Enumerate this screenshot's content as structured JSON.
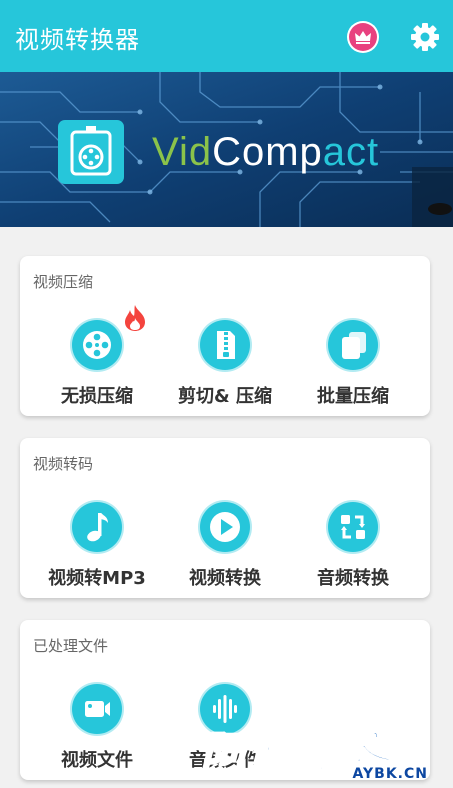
{
  "app": {
    "title": "视频转换器"
  },
  "topbar": {
    "vip_icon": "crown-icon",
    "settings_icon": "gear-icon",
    "accent": "#26c6da",
    "vip_color": "#e8417f"
  },
  "banner": {
    "brand_part1": "Vid",
    "brand_part2": "Comp",
    "brand_part3": "act",
    "colors": [
      "#8bc34a",
      "#ffffff",
      "#26c6da"
    ]
  },
  "sections": [
    {
      "title": "视频压缩",
      "items": [
        {
          "label": "无损压缩",
          "icon": "film-reel-icon",
          "badge": "fire-icon"
        },
        {
          "label": "剪切& 压缩",
          "icon": "zip-file-icon"
        },
        {
          "label": "批量压缩",
          "icon": "stacked-files-icon"
        }
      ]
    },
    {
      "title": "视频转码",
      "items": [
        {
          "label": "视频转MP3",
          "icon": "music-note-icon"
        },
        {
          "label": "视频转换",
          "icon": "play-icon"
        },
        {
          "label": "音频转换",
          "icon": "convert-arrows-icon"
        }
      ]
    },
    {
      "title": "已处理文件",
      "items": [
        {
          "label": "视频文件",
          "icon": "video-camera-icon"
        },
        {
          "label": "音频文件",
          "icon": "sound-wave-icon"
        }
      ]
    }
  ],
  "watermark": {
    "text": "阿影博客",
    "sub": "AYBK.CN"
  }
}
